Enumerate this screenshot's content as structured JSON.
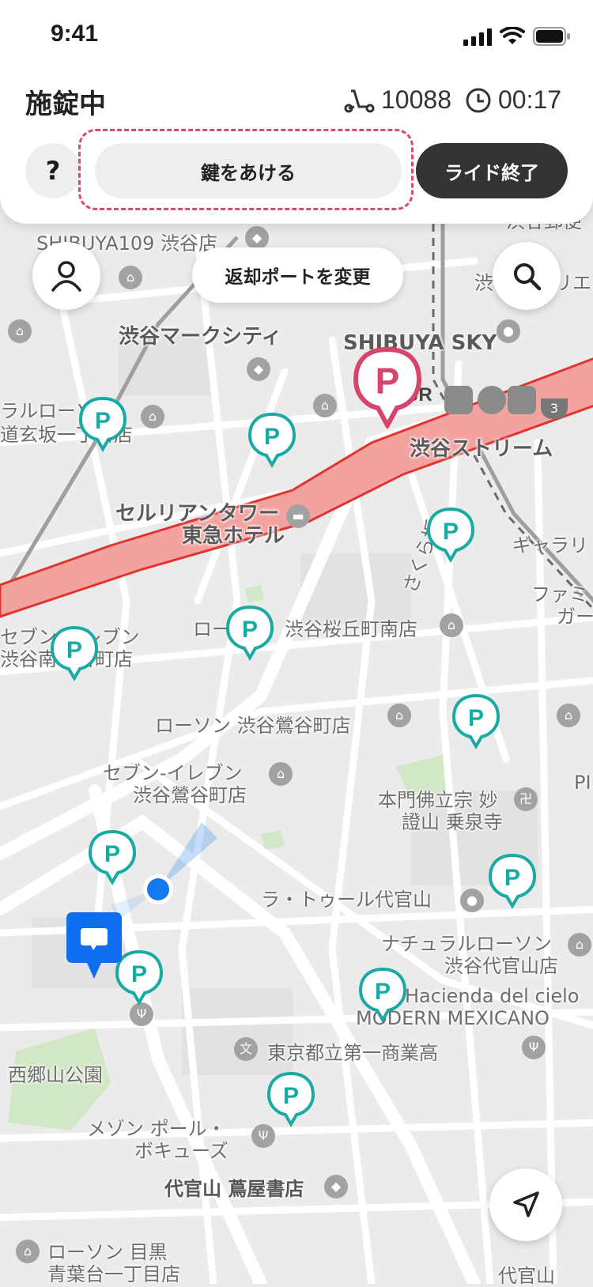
{
  "status_bar": {
    "time": "9:41"
  },
  "ride": {
    "state_title": "施錠中",
    "vehicle_id": "10088",
    "elapsed": "00:17"
  },
  "actions": {
    "help": "?",
    "unlock": "鍵をあける",
    "end_ride": "ライド終了",
    "change_port": "返却ポートを変更"
  },
  "colors": {
    "port_teal": "#19aaa4",
    "selected_port": "#d6456b",
    "route_fill": "#f2a3a0",
    "route_stroke": "#e2332f",
    "user_blue": "#1479f0",
    "dark_button": "#333333"
  },
  "icons": [
    "signal-icon",
    "wifi-icon",
    "battery-icon",
    "scooter-icon",
    "clock-icon",
    "person-icon",
    "search-icon",
    "navigate-arrow-icon"
  ],
  "map_labels": {
    "shibuya109": "SHIBUYA109 渋谷店",
    "mark_city": "渋谷マークシティ",
    "shibuya_sky": "SHIBUYA SKY",
    "natural_lawson1": "ラルローソン",
    "dogenzaka": "道玄坂一丁目店",
    "cerulean1": "セルリアンタワー",
    "cerulean2": "東急ホテル",
    "stream": "渋谷ストリーム",
    "sakurazaka": "さくら坂",
    "gallery": "ギャラリ",
    "famima1": "ファミ",
    "famima2": "ガー",
    "seven1_a": "セブン-イレブン",
    "seven1_b": "渋谷南平台町店",
    "lawson_short": "ロー",
    "sakuragaoka": "渋谷桜丘町南店",
    "lawson_uguisu": "ローソン 渋谷鶯谷町店",
    "seven2_a": "セブン-イレブン",
    "seven2_b": "渋谷鶯谷町店",
    "temple1": "本門佛立宗 妙",
    "temple2": "證山 乗泉寺",
    "la_tour": "ラ・トゥール代官山",
    "natural_lawson2_a": "ナチュラルローソン",
    "natural_lawson2_b": "渋谷代官山店",
    "hacienda1": "Hacienda del cielo",
    "hacienda2": "MODERN MEXICANO",
    "highschool": "東京都立第一商業高",
    "saigoyama": "西郷山公園",
    "maison1": "メゾン ポール・",
    "maison2": "ボキューズ",
    "tsutaya": "代官山 蔦屋書店",
    "lawson_meguro1": "ローソン 目黒",
    "lawson_meguro2": "青葉台一丁目店",
    "daikanyama_station": "代官山",
    "pi": "PI",
    "right_edge1": "渋谷郵便",
    "right_edge2": "リエ",
    "shibuya_left": "渋",
    "jr": "JR",
    "line_badge": "3"
  }
}
